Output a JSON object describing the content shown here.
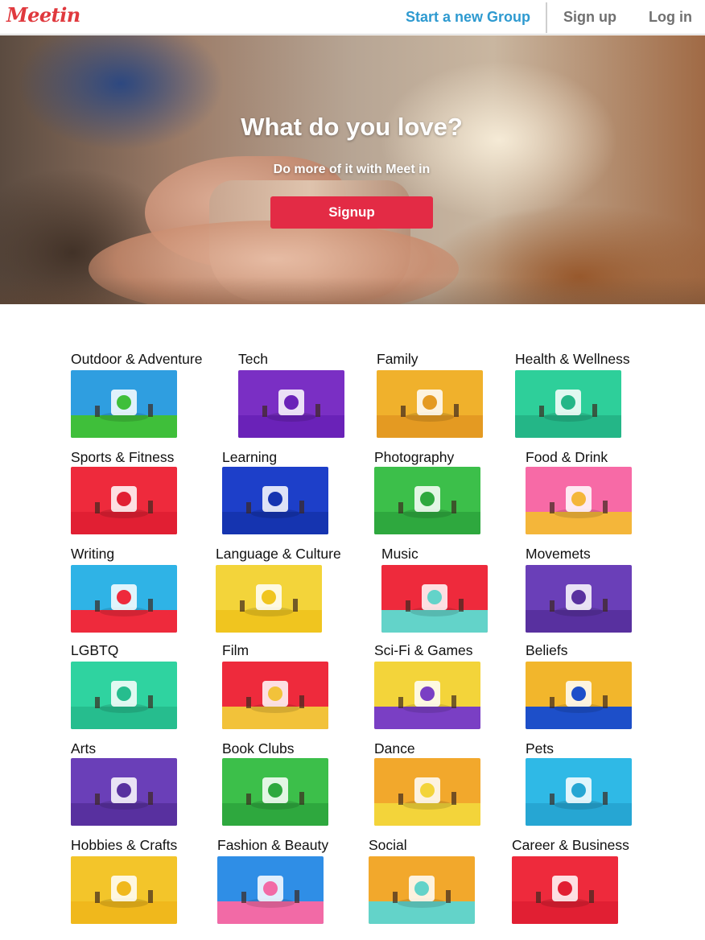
{
  "header": {
    "logo": "Meetin",
    "start_group": "Start a new Group",
    "signup": "Sign up",
    "login": "Log in"
  },
  "hero": {
    "title": "What do you love?",
    "subtitle": "Do more of it with Meet in",
    "button": "Signup"
  },
  "categories": [
    {
      "label": "Outdoor & Adventure",
      "icon": "tent-bear-illustration",
      "colors": [
        "#2f9ee0",
        "#3fbf3a"
      ]
    },
    {
      "label": "Tech",
      "icon": "computer-illustration",
      "colors": [
        "#7a2fc4",
        "#6a22b8"
      ]
    },
    {
      "label": "Family",
      "icon": "baby-highchair-illustration",
      "colors": [
        "#f0b12c",
        "#e49a22"
      ]
    },
    {
      "label": "Health & Wellness",
      "icon": "heart-organ-illustration",
      "colors": [
        "#2ecf9a",
        "#24b687"
      ]
    },
    {
      "label": "Sports & Fitness",
      "icon": "weightlifters-illustration",
      "colors": [
        "#ee2a3c",
        "#e11f33"
      ]
    },
    {
      "label": "Learning",
      "icon": "brain-lifting-illustration",
      "colors": [
        "#1d3fc9",
        "#1534b0"
      ]
    },
    {
      "label": "Photography",
      "icon": "instant-camera-illustration",
      "colors": [
        "#3cbf4a",
        "#2ea83e"
      ]
    },
    {
      "label": "Food & Drink",
      "icon": "sushi-illustration",
      "colors": [
        "#f76aa6",
        "#f4b63a"
      ]
    },
    {
      "label": "Writing",
      "icon": "typewriter-illustration",
      "colors": [
        "#2fb3e6",
        "#ee2a3c"
      ]
    },
    {
      "label": "Language & Culture",
      "icon": "speech-bubbles-illustration",
      "colors": [
        "#f3d43a",
        "#f0c51f"
      ]
    },
    {
      "label": "Music",
      "icon": "boombox-illustration",
      "colors": [
        "#ee2a3c",
        "#63d3c9"
      ]
    },
    {
      "label": "Movemets",
      "icon": "protest-signs-illustration",
      "colors": [
        "#6a3fb8",
        "#58309f"
      ]
    },
    {
      "label": "LGBTQ",
      "icon": "unicorn-rainbow-illustration",
      "colors": [
        "#2fd3a0",
        "#26bd8e"
      ]
    },
    {
      "label": "Film",
      "icon": "popcorn-tv-illustration",
      "colors": [
        "#ee2a3c",
        "#f2c23a"
      ]
    },
    {
      "label": "Sci-Fi & Games",
      "icon": "card-house-illustration",
      "colors": [
        "#f3d43a",
        "#7a3fc4"
      ]
    },
    {
      "label": "Beliefs",
      "icon": "praying-hands-illustration",
      "colors": [
        "#f2b62c",
        "#1d4fc9"
      ]
    },
    {
      "label": "Arts",
      "icon": "painting-easel-illustration",
      "colors": [
        "#6a3fb8",
        "#58309f"
      ]
    },
    {
      "label": "Book Clubs",
      "icon": "book-readers-illustration",
      "colors": [
        "#3cbf4a",
        "#2ea83e"
      ]
    },
    {
      "label": "Dance",
      "icon": "dancer-illustration",
      "colors": [
        "#f2a82c",
        "#f3d43a"
      ]
    },
    {
      "label": "Pets",
      "icon": "pet-costumes-illustration",
      "colors": [
        "#2fb9e6",
        "#26a6d3"
      ]
    },
    {
      "label": "Hobbies & Crafts",
      "icon": "embroidery-hoop-illustration",
      "colors": [
        "#f3c52a",
        "#f0b81c"
      ]
    },
    {
      "label": "Fashion & Beauty",
      "icon": "fashion-model-illustration",
      "colors": [
        "#2f8ee6",
        "#f26aa6"
      ]
    },
    {
      "label": "Social",
      "icon": "dancing-crowd-illustration",
      "colors": [
        "#f2a82c",
        "#63d3c9"
      ]
    },
    {
      "label": "Career & Business",
      "icon": "business-people-illustration",
      "colors": [
        "#ee2a3c",
        "#e11f33"
      ]
    }
  ]
}
